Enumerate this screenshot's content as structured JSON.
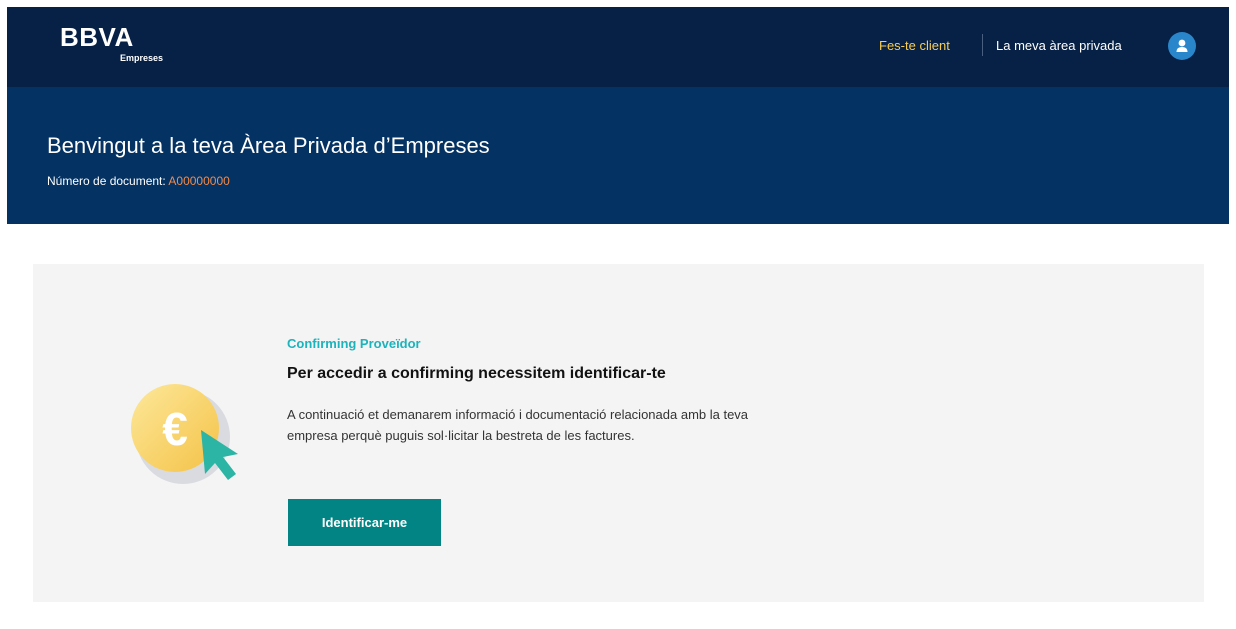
{
  "header": {
    "logo_text": "BBVA",
    "logo_subtext": "Empreses",
    "become_client_link": "Fes-te client",
    "private_area_link": "La meva àrea privada",
    "avatar_icon": "user-icon"
  },
  "hero": {
    "title": "Benvingut a la teva Àrea Privada d’Empreses",
    "document_label": "Número de document:",
    "document_value": "A00000000"
  },
  "card": {
    "eyebrow": "Confirming Proveïdor",
    "title": "Per accedir a confirming necessitem identificar-te",
    "description": "A continuació et demanarem informació i documentació relacionada amb la teva empresa perquè puguis sol·licitar la bestreta de les factures.",
    "button_label": "Identificar-me",
    "illustration_icon": "euro-coin-cursor-icon"
  },
  "colors": {
    "topbar": "#072146",
    "hero": "#043263",
    "accent_yellow": "#f8cd51",
    "doc_orange": "#f38b4a",
    "eyebrow_aqua": "#1bb3bc",
    "button_teal": "#028484",
    "card_bg": "#f4f4f4"
  }
}
